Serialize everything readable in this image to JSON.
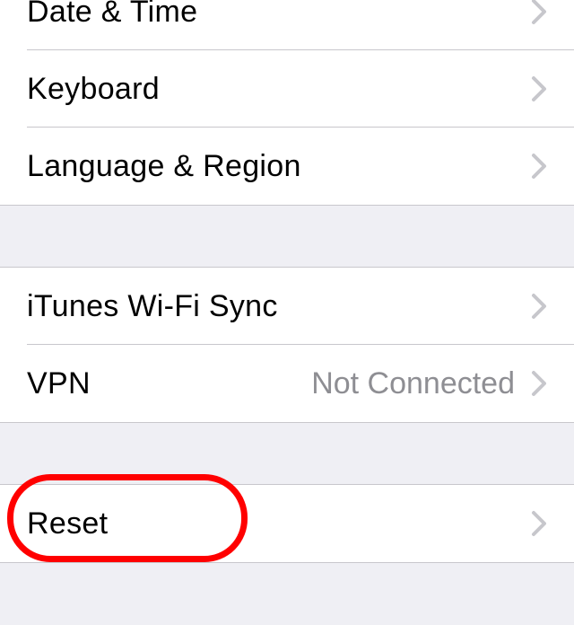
{
  "section1": {
    "items": [
      {
        "label": "Date & Time"
      },
      {
        "label": "Keyboard"
      },
      {
        "label": "Language & Region"
      }
    ]
  },
  "section2": {
    "items": [
      {
        "label": "iTunes Wi-Fi Sync",
        "value": ""
      },
      {
        "label": "VPN",
        "value": "Not Connected"
      }
    ]
  },
  "section3": {
    "items": [
      {
        "label": "Reset"
      }
    ]
  }
}
